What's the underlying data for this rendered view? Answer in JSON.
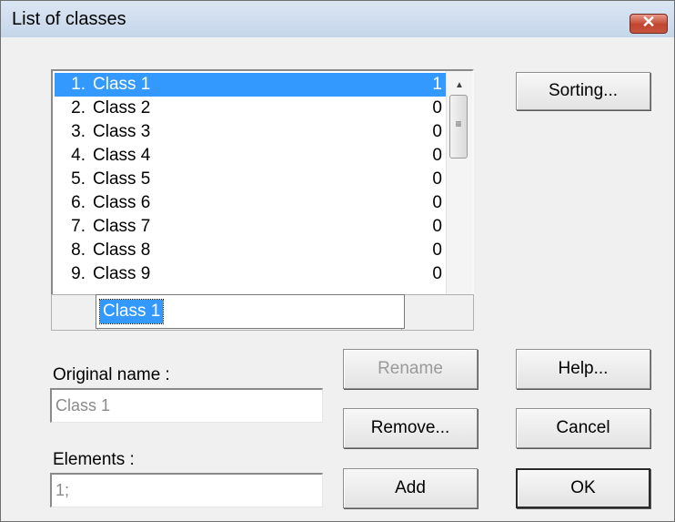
{
  "window": {
    "title": "List of classes",
    "close_glyph": "✕"
  },
  "classes": [
    {
      "num": "1.",
      "name": "Class 1",
      "count": "1",
      "selected": true
    },
    {
      "num": "2.",
      "name": "Class 2",
      "count": "0"
    },
    {
      "num": "3.",
      "name": "Class 3",
      "count": "0"
    },
    {
      "num": "4.",
      "name": "Class 4",
      "count": "0"
    },
    {
      "num": "5.",
      "name": "Class 5",
      "count": "0"
    },
    {
      "num": "6.",
      "name": "Class 6",
      "count": "0"
    },
    {
      "num": "7.",
      "name": "Class 7",
      "count": "0"
    },
    {
      "num": "8.",
      "name": "Class 8",
      "count": "0"
    },
    {
      "num": "9.",
      "name": "Class 9",
      "count": "0"
    }
  ],
  "rename_input": {
    "value": "Class 1"
  },
  "buttons": {
    "sorting": "Sorting...",
    "rename": "Rename",
    "help": "Help...",
    "remove": "Remove...",
    "cancel": "Cancel",
    "add": "Add",
    "ok": "OK"
  },
  "original_name": {
    "label": "Original name :",
    "value": "Class 1"
  },
  "elements": {
    "label": "Elements :",
    "value": "1;"
  },
  "colors": {
    "selection": "#3399ff",
    "close_button": "#c7432f",
    "titlebar": "#cfdcee"
  }
}
